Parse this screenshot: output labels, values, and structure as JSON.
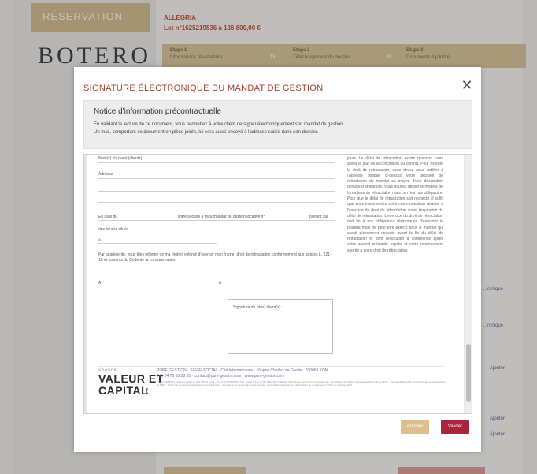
{
  "background": {
    "reservation_label": "RÉSERVATION",
    "brand": "BOTERO",
    "lot_label": "ALLEGRIA",
    "lot_value": "Lot n°1625219536 à 136 800,00 €",
    "steps": [
      {
        "title": "Etape 1",
        "subtitle": "Informations réservataire"
      },
      {
        "title": "Etape 2",
        "subtitle": "Téléchargement du dossier"
      },
      {
        "title": "Etape 3",
        "subtitle": "Documents à joindre"
      }
    ],
    "step_separator": "»",
    "right_links": [
      "...ronique",
      "...ronique",
      "Ajouter",
      "Ajouter",
      "Ajouter"
    ]
  },
  "modal": {
    "title": "SIGNATURE ÉLECTRONIQUE DU MANDAT DE GESTION",
    "close_icon": "close-icon",
    "notice": {
      "title": "Notice d'information précontractuelle",
      "line1": "En validant la lecture de ce document, vous permettez à votre client de signer électroniquement son mandat de gestion.",
      "line2": "Un mail, comportant ce document en pièce jointe, lui sera aussi envoyé à l'adresse saisie dans son dossier."
    },
    "document": {
      "top_label": "Nom(s) du client (clients)",
      "adresse_label": "Adresse",
      "date_text": "En date du",
      "date_mid": ", votre société a reçu mandat de gestion locative n°",
      "portant_sur": "portant sur",
      "biens_label": "des locaux situés",
      "a_label": "à",
      "paragraph": "Par la présente, vous êtes informé de ma (notre) volonté d'exercer mon (notre) droit de rétractation conformément aux articles L. 221-18 et suivants du Code de la consommation.",
      "place_label": "À",
      "date_label": ", le",
      "signature_label": "Signature du (des) client(s) :",
      "right_column": "jours. Le délai de rétractation expire quatorze jours après le jour de la conclusion du contrat. Pour exercer le droit de rétractation, vous devez nous notifier à l'adresse postale ci-dessus votre décision de rétractation du mandat au moyen d'une déclaration dénuée d'ambiguïté. Vous pouvez utiliser le modèle de formulaire de rétractation mais ce n'est pas obligatoire. Pour que le délai de rétractation soit respecté, il suffit que vous transmettiez votre communication relative à l'exercice du droit de rétractation avant l'expiration du délai de rétractation. L'exercice du droit de rétractation met fin à vos obligations réciproques d'exécuter le mandat mais ne peut être exercé pour le mandat qui aurait pleinement exécuté avant la fin du délai de rétractation et dont l'exécution a commencé après votre accord préalable exprès et votre renoncement exprès à votre droit de rétractation.",
      "footer": {
        "groupe": "GROUPE",
        "brand_line1": "VALEUR ET",
        "brand_line2": "CAPITAL",
        "brand_glyph": "ℓ",
        "line1": "PURE GESTION · SIÈGE SOCIAL · Cité Internationale · 16 quai Charles de Gaulle · 69006 LYON",
        "line2": "Tél. 04 78 63 58 55 · contact@pure-gestion.com · www.pure-gestion.com",
        "legal": "PURE GESTION · SAS au capital de 100 000,00 euros · R.C.S. LYON 455 541 547 · Carte T & G n° CPI 6901 2017 000 020 798 délivrée par la CCI Lyon Métropole · Enregistrée à l'ORIAS. Garantie de fonds par la CEGC · Responsabilité civile professionnelle souscrite auprès de MMA · Sise 6 rue du Docteur Saint-Pierre Laurent Boudet · Assurance du siège et du lieu de l'activité. Garantie financière au titre de l'article 3 de la loi Hoguet n° 70-9 du 2 janvier 1970."
      }
    },
    "buttons": {
      "cancel": "Annuler",
      "validate": "Valider"
    }
  }
}
